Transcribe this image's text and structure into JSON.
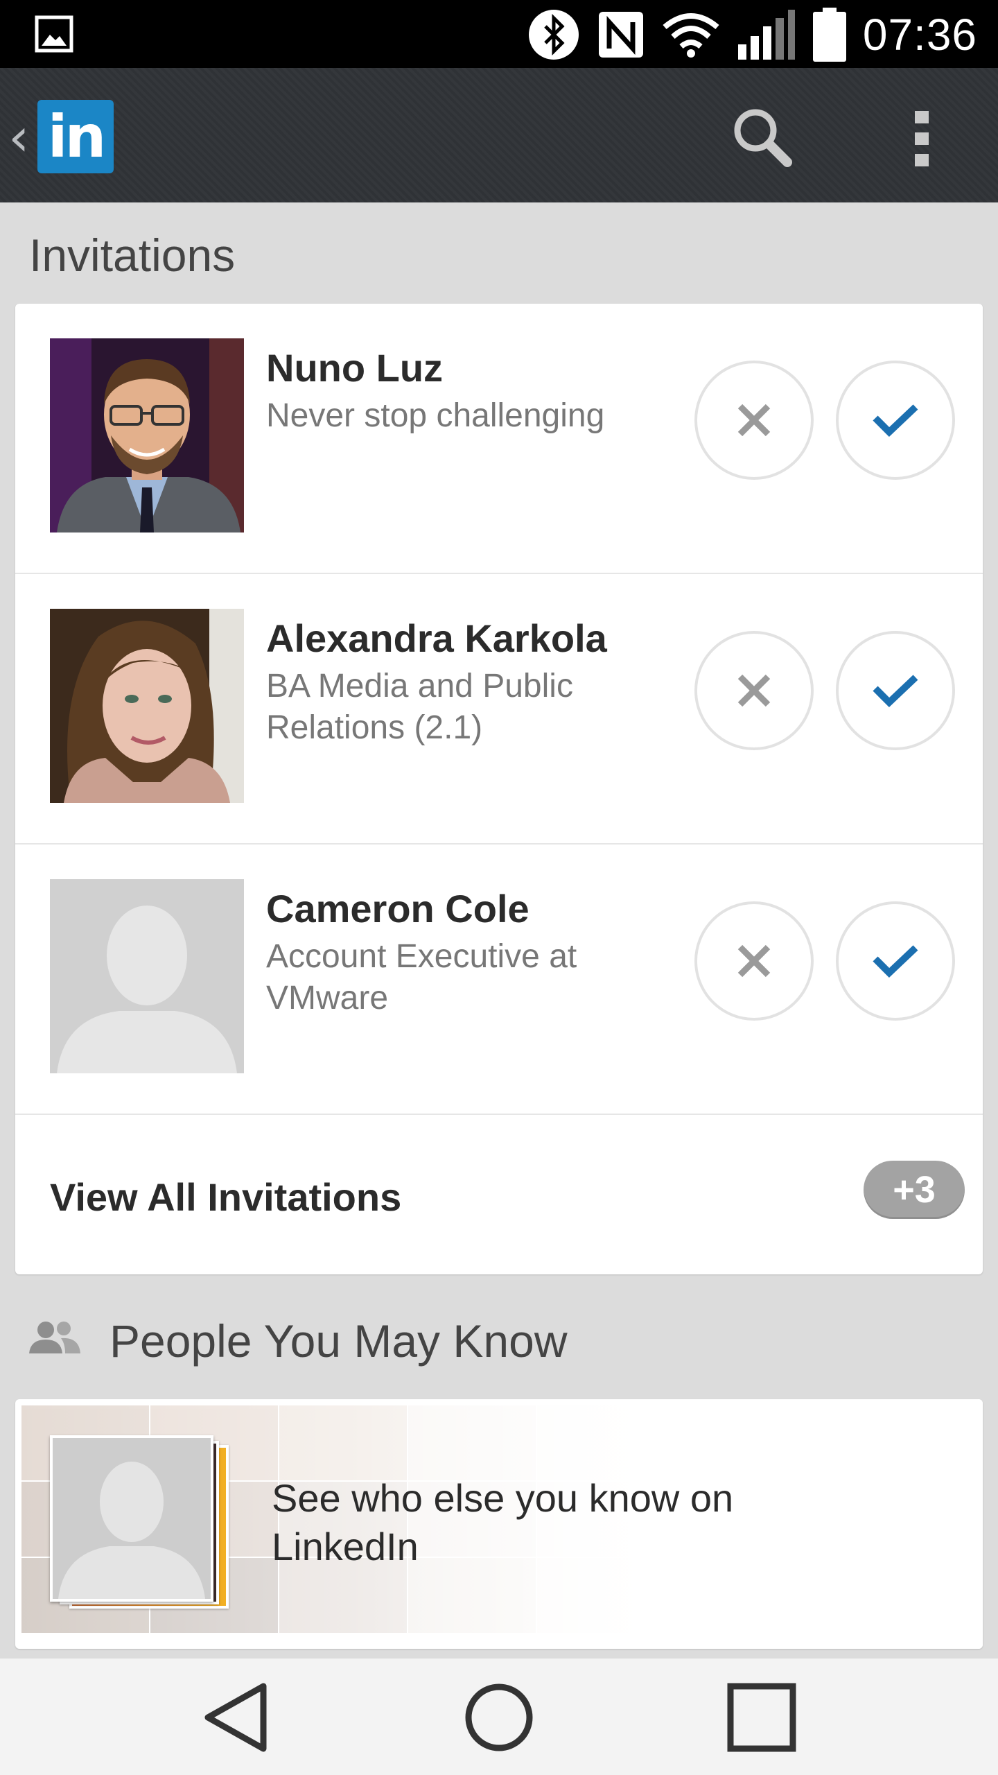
{
  "status_bar": {
    "time": "07:36",
    "icons": [
      "gallery-icon",
      "bluetooth-icon",
      "nfc-icon",
      "wifi-icon",
      "signal-icon",
      "battery-icon"
    ]
  },
  "action_bar": {
    "logo_text": "in",
    "icons": [
      "back-chevron-icon",
      "search-icon",
      "overflow-menu-icon"
    ],
    "brand_color": "#1b86c6"
  },
  "invitations": {
    "title": "Invitations",
    "items": [
      {
        "name": "Nuno Luz",
        "headline": "Never stop challenging",
        "avatar": "photo"
      },
      {
        "name": "Alexandra Karkola",
        "headline": "BA Media and Public Relations (2.1)",
        "avatar": "photo"
      },
      {
        "name": "Cameron Cole",
        "headline": "Account Executive at VMware",
        "avatar": "placeholder"
      }
    ],
    "view_all_label": "View All Invitations",
    "more_count": "+3",
    "accent_color": "#1b6fb0"
  },
  "pymk": {
    "title": "People You May Know",
    "promo_text": "See who else you know on LinkedIn"
  },
  "nav_bar": {
    "icons": [
      "back-triangle-icon",
      "home-circle-icon",
      "recents-square-icon"
    ]
  }
}
